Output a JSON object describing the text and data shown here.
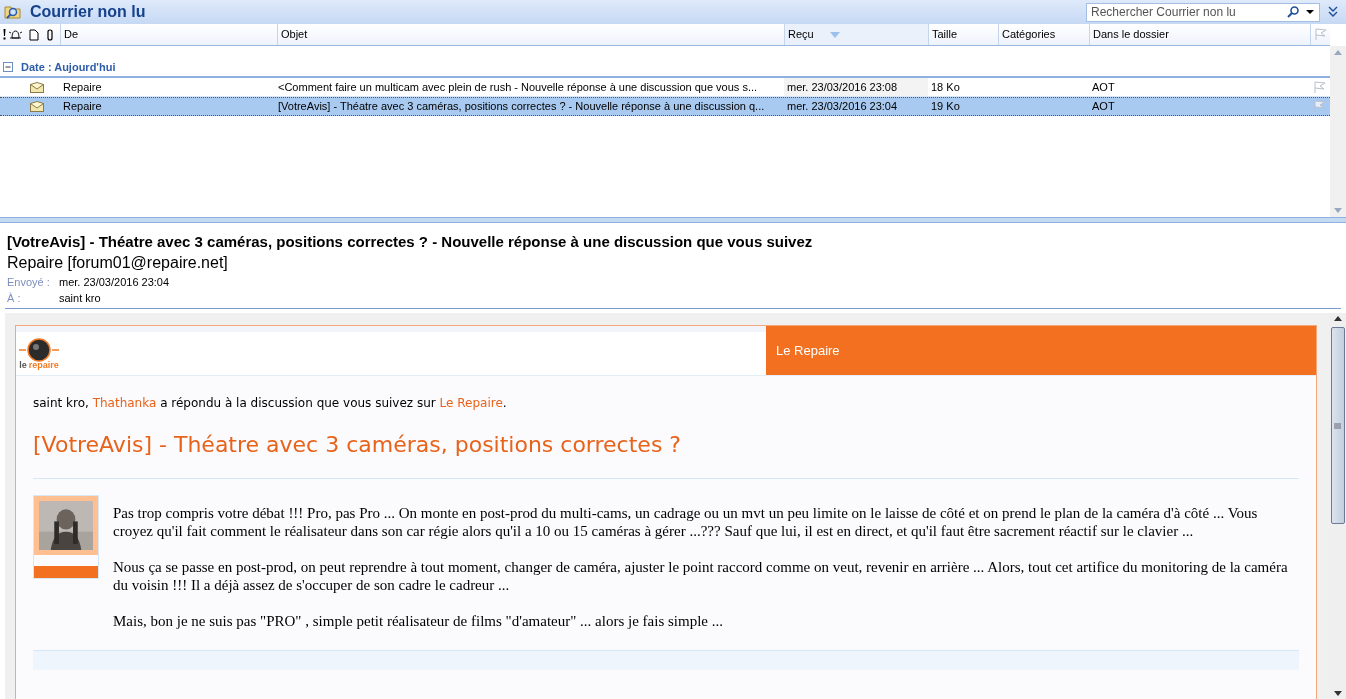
{
  "folder": {
    "title": "Courrier non lu",
    "search": {
      "placeholder": "Rechercher Courrier non lu"
    }
  },
  "columns": [
    {
      "label": "De",
      "sorted": false
    },
    {
      "label": "Objet",
      "sorted": false
    },
    {
      "label": "Reçu",
      "sorted": true
    },
    {
      "label": "Taille",
      "sorted": false
    },
    {
      "label": "Catégories",
      "sorted": false
    },
    {
      "label": "Dans le dossier",
      "sorted": false
    }
  ],
  "group": {
    "label": "Date : Aujourd'hui",
    "expanded": true
  },
  "messages": [
    {
      "from": "Repaire",
      "subject": "<Comment faire un multicam avec plein de rush - Nouvelle réponse à une discussion que vous s...",
      "received": "mer. 23/03/2016 23:08",
      "size": "18 Ko",
      "folder": "AOT",
      "selected": false
    },
    {
      "from": "Repaire",
      "subject": "[VotreAvis] - Théatre avec 3 caméras, positions correctes ? - Nouvelle réponse à une discussion q...",
      "received": "mer. 23/03/2016 23:04",
      "size": "19 Ko",
      "folder": "AOT",
      "selected": true
    }
  ],
  "reading": {
    "subject": "[VotreAvis] - Théatre avec 3 caméras, positions correctes ? - Nouvelle réponse à une discussion que vous suivez",
    "sender": "Repaire [forum01@repaire.net]",
    "fields": [
      {
        "label": "Envoyé :",
        "value": "mer. 23/03/2016 23:04"
      },
      {
        "label": "À :",
        "value": "saint kro"
      }
    ]
  },
  "email": {
    "logo_text": "repaire",
    "logo_prefix": "le",
    "banner": "Le Repaire",
    "intro": [
      {
        "kind": "text",
        "text": "saint kro, "
      },
      {
        "kind": "link",
        "text": "Thathanka"
      },
      {
        "kind": "text",
        "text": " a répondu à la discussion que vous suivez sur "
      },
      {
        "kind": "link",
        "text": "Le Repaire"
      },
      {
        "kind": "text",
        "text": "."
      }
    ],
    "heading": "[VotreAvis] - Théatre avec 3 caméras, positions correctes ?",
    "post": {
      "paragraphs": [
        "Pas trop compris votre débat !!! Pro, pas Pro ... On monte en post-prod du multi-cams, un cadrage ou un mvt un peu limite on le laisse de côté et on prend le plan de la caméra d'à côté ... Vous croyez qu'il fait comment le réalisateur dans son car régie alors qu'il a 10 ou 15 caméras à gérer ...??? Sauf que lui, il est en direct, et qu'il faut être sacrement réactif sur le clavier ...",
        "Nous ça se passe en post-prod, on peut reprendre à tout moment, changer de caméra, ajuster le point raccord comme on veut, revenir en arrière ... Alors, tout cet artifice du monitoring de la caméra du voisin !!! Il a déjà assez de s'occuper de son cadre le cadreur ...",
        "Mais, bon je ne suis pas \"PRO\" , simple petit réalisateur de films \"d'amateur\" ... alors je fais simple ..."
      ]
    }
  }
}
